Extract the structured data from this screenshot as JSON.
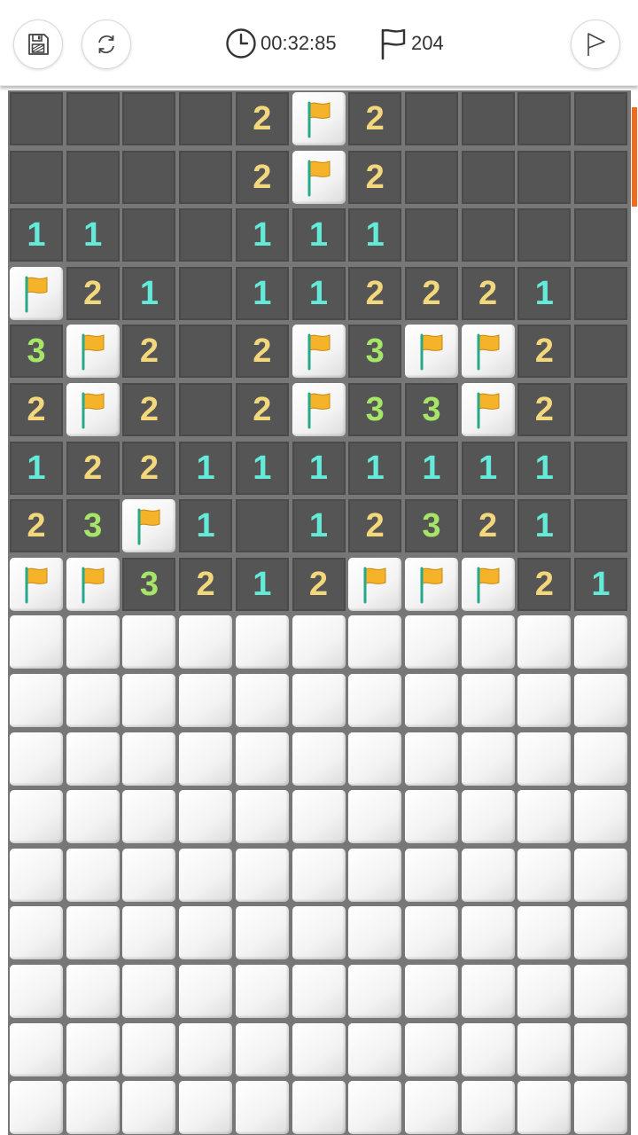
{
  "header": {
    "save_icon": "save-icon",
    "restart_icon": "restart-icon",
    "timer_icon": "clock-icon",
    "timer": "00:32:85",
    "flag_icon": "flag-outline-icon",
    "flags_count": "204",
    "flag_mode_icon": "flag-mode-icon"
  },
  "board": {
    "columns": 11,
    "visible_rows": 18,
    "legend": "c = unopened cell, f = flag, o = opened empty, 1-3 = mine count",
    "rows": [
      [
        "o",
        "o",
        "o",
        "o",
        "2",
        "f",
        "2",
        "o",
        "o",
        "o",
        "o"
      ],
      [
        "o",
        "o",
        "o",
        "o",
        "2",
        "f",
        "2",
        "o",
        "o",
        "o",
        "o"
      ],
      [
        "1",
        "1",
        "o",
        "o",
        "1",
        "1",
        "1",
        "o",
        "o",
        "o",
        "o"
      ],
      [
        "f",
        "2",
        "1",
        "o",
        "1",
        "1",
        "2",
        "2",
        "2",
        "1",
        "o"
      ],
      [
        "3",
        "f",
        "2",
        "o",
        "2",
        "f",
        "3",
        "f",
        "f",
        "2",
        "o"
      ],
      [
        "2",
        "f",
        "2",
        "o",
        "2",
        "f",
        "3",
        "3",
        "f",
        "2",
        "o"
      ],
      [
        "1",
        "2",
        "2",
        "1",
        "1",
        "1",
        "1",
        "1",
        "1",
        "1",
        "o"
      ],
      [
        "2",
        "3",
        "f",
        "1",
        "o",
        "1",
        "2",
        "3",
        "2",
        "1",
        "o"
      ],
      [
        "f",
        "f",
        "3",
        "2",
        "1",
        "2",
        "f",
        "f",
        "f",
        "2",
        "1"
      ],
      [
        "c",
        "c",
        "c",
        "c",
        "c",
        "c",
        "c",
        "c",
        "c",
        "c",
        "c"
      ],
      [
        "c",
        "c",
        "c",
        "c",
        "c",
        "c",
        "c",
        "c",
        "c",
        "c",
        "c"
      ],
      [
        "c",
        "c",
        "c",
        "c",
        "c",
        "c",
        "c",
        "c",
        "c",
        "c",
        "c"
      ],
      [
        "c",
        "c",
        "c",
        "c",
        "c",
        "c",
        "c",
        "c",
        "c",
        "c",
        "c"
      ],
      [
        "c",
        "c",
        "c",
        "c",
        "c",
        "c",
        "c",
        "c",
        "c",
        "c",
        "c"
      ],
      [
        "c",
        "c",
        "c",
        "c",
        "c",
        "c",
        "c",
        "c",
        "c",
        "c",
        "c"
      ],
      [
        "c",
        "c",
        "c",
        "c",
        "c",
        "c",
        "c",
        "c",
        "c",
        "c",
        "c"
      ],
      [
        "c",
        "c",
        "c",
        "c",
        "c",
        "c",
        "c",
        "c",
        "c",
        "c",
        "c"
      ],
      [
        "c",
        "c",
        "c",
        "c",
        "c",
        "c",
        "c",
        "c",
        "c",
        "c",
        "c"
      ]
    ]
  },
  "colors": {
    "number_1": "#63ead8",
    "number_2": "#f3d77d",
    "number_3": "#a6e567",
    "flag": "#f5b32a",
    "scroll_thumb": "#f26a1b"
  }
}
